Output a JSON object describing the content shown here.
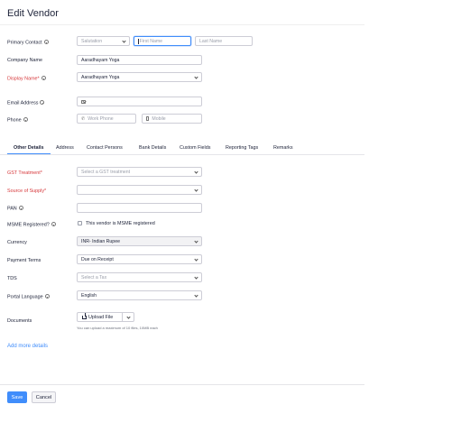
{
  "page": {
    "title": "Edit Vendor"
  },
  "primary_contact": {
    "label": "Primary Contact",
    "salutation_placeholder": "Salutation",
    "first_name_placeholder": "First Name",
    "last_name_placeholder": "Last Name"
  },
  "company_name": {
    "label": "Company Name",
    "value": "Aaradhayam Yoga"
  },
  "display_name": {
    "label": "Display Name*",
    "value": "Aaradhayam Yoga"
  },
  "email": {
    "label": "Email Address",
    "value": "",
    "icon": "mail-icon"
  },
  "phone": {
    "label": "Phone",
    "work_placeholder": "Work Phone",
    "mobile_placeholder": "Mobile",
    "work_icon": "phone-icon",
    "mobile_icon": "mobile-icon"
  },
  "tabs": [
    {
      "label": "Other Details",
      "active": true
    },
    {
      "label": "Address"
    },
    {
      "label": "Contact Persons"
    },
    {
      "label": "Bank Details"
    },
    {
      "label": "Custom Fields"
    },
    {
      "label": "Reporting Tags"
    },
    {
      "label": "Remarks"
    }
  ],
  "other_details": {
    "gst_treatment": {
      "label": "GST Treatment*",
      "placeholder": "Select a GST treatment"
    },
    "source_of_supply": {
      "label": "Source of Supply*",
      "value": ""
    },
    "pan": {
      "label": "PAN",
      "value": ""
    },
    "msme": {
      "label": "MSME Registered?",
      "checkbox_label": "This vendor is MSME registered",
      "checked": false
    },
    "currency": {
      "label": "Currency",
      "value": "INR- Indian Rupee"
    },
    "payment_terms": {
      "label": "Payment Terms",
      "value": "Due on Receipt"
    },
    "tds": {
      "label": "TDS",
      "placeholder": "Select a Tax"
    },
    "portal_language": {
      "label": "Portal Language",
      "value": "English"
    },
    "documents": {
      "label": "Documents",
      "upload_label": "Upload File",
      "hint": "You can upload a maximum of 10 files, 10MB each"
    }
  },
  "add_more_details": "Add more details",
  "footer": {
    "save_label": "Save",
    "cancel_label": "Cancel"
  },
  "colors": {
    "accent": "#408dfb",
    "required": "#d6373a",
    "border": "#cdcdd6"
  }
}
